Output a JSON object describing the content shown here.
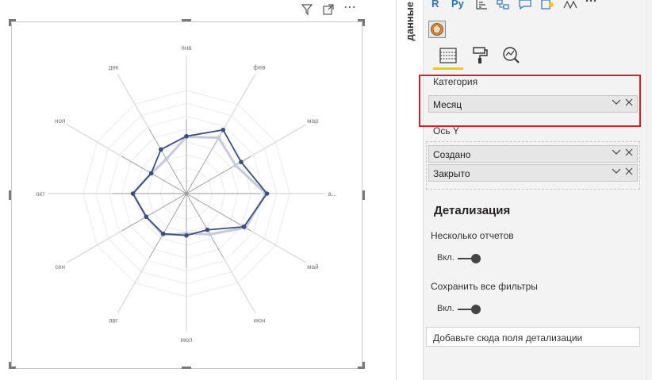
{
  "visual": {
    "header_icons": [
      "filter-icon",
      "focus-mode-icon",
      "more-options-icon"
    ],
    "more_options_glyph": "⋯"
  },
  "pane": {
    "title": "данные",
    "viz_icon_labels": [
      "R",
      "Py"
    ],
    "tabs": [
      "fields-tab",
      "format-tab",
      "analytics-tab"
    ],
    "wells": {
      "category": {
        "label": "Категория",
        "fields": [
          "Месяц"
        ]
      },
      "y_axis": {
        "label": "Ось Y",
        "fields": [
          "Создано",
          "Закрыто"
        ]
      }
    },
    "drillthrough": {
      "heading": "Детализация",
      "cross_report_label": "Несколько отчетов",
      "cross_report_value": "Вкл.",
      "keep_filters_label": "Сохранить все фильтры",
      "keep_filters_value": "Вкл.",
      "add_fields_placeholder": "Добавьте сюда поля детализации"
    },
    "colors": {
      "highlight": "#e02020",
      "active_tab_underline": "#f2c811"
    }
  },
  "chart_data": {
    "type": "radar",
    "categories": [
      "янв",
      "фев",
      "мар",
      "а...",
      "май",
      "июн",
      "июл",
      "авг",
      "сен",
      "окт",
      "ноя",
      "дек"
    ],
    "series": [
      {
        "values": [
          0.88,
          1.0,
          0.88,
          1.23,
          1.06,
          0.73,
          0.62,
          0.74,
          0.72,
          0.83,
          0.63,
          0.62
        ],
        "color": "#c6cbdc"
      },
      {
        "values": [
          0.89,
          1.14,
          0.98,
          1.25,
          1.03,
          0.65,
          0.65,
          0.72,
          0.72,
          0.83,
          0.63,
          0.79
        ],
        "color": "#3f4d7d"
      }
    ],
    "rmax": 1.6,
    "rings": 8,
    "legend": false
  }
}
